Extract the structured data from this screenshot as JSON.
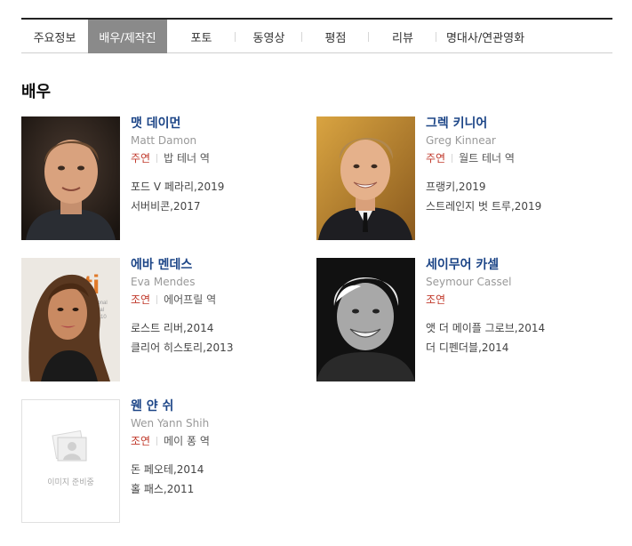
{
  "tabs": [
    {
      "label": "주요정보",
      "active": false
    },
    {
      "label": "배우/제작진",
      "active": true
    },
    {
      "label": "포토",
      "active": false
    },
    {
      "label": "동영상",
      "active": false
    },
    {
      "label": "평점",
      "active": false
    },
    {
      "label": "리뷰",
      "active": false
    },
    {
      "label": "명대사/연관영화",
      "active": false
    }
  ],
  "section_title": "배우",
  "actors": [
    {
      "name": "맷 데이먼",
      "english_name": "Matt Damon",
      "role_type": "주연",
      "role": "밥 테너 역",
      "films": [
        "포드 V 페라리,2019",
        "서버비콘,2017"
      ],
      "photo": "portrait-man-short-hair"
    },
    {
      "name": "그렉 키니어",
      "english_name": "Greg Kinnear",
      "role_type": "주연",
      "role": "월트 테너 역",
      "films": [
        "프랭키,2019",
        "스트레인지 벗 트루,2019"
      ],
      "photo": "portrait-man-suit"
    },
    {
      "name": "에바 멘데스",
      "english_name": "Eva Mendes",
      "role_type": "조연",
      "role": "에어프릴 역",
      "films": [
        "로스트 리버,2014",
        "클리어 히스토리,2013"
      ],
      "photo": "portrait-woman-long-hair"
    },
    {
      "name": "세이무어 카셀",
      "english_name": "Seymour Cassel",
      "role_type": "조연",
      "role": "",
      "films": [
        "앳 더 메이플 그로브,2014",
        "더 디펜더블,2014"
      ],
      "photo": "portrait-old-man-bw"
    },
    {
      "name": "웬 얀 쉬",
      "english_name": "Wen Yann Shih",
      "role_type": "조연",
      "role": "메이 퐁 역",
      "films": [
        "돈 페오테,2014",
        "홀 패스,2011"
      ],
      "photo": "image-placeholder",
      "placeholder_text": "이미지 준비중"
    }
  ],
  "colors": {
    "actor_name": "#1c4587",
    "role_type": "#c0392b",
    "active_tab": "#8a8a8a"
  }
}
